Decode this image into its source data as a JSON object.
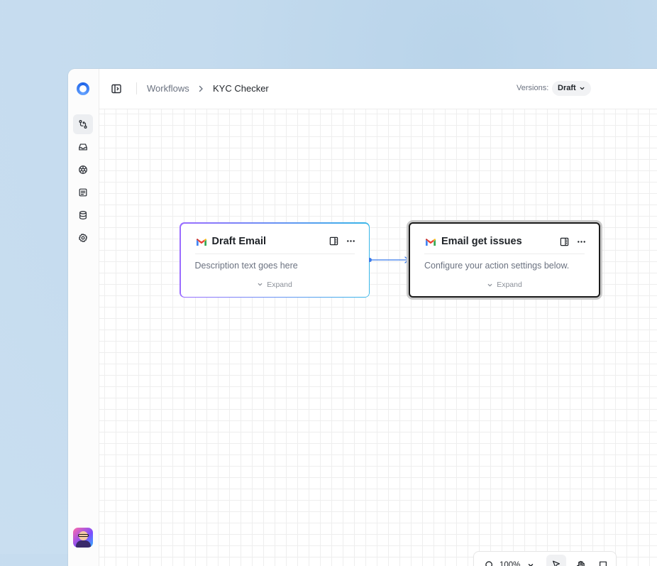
{
  "app": {
    "breadcrumb": [
      "Workflows",
      "KYC Checker"
    ],
    "versions_label": "Versions:",
    "version_value": "Draft"
  },
  "sidebar": {
    "items": [
      {
        "icon": "workflow-icon",
        "active": true
      },
      {
        "icon": "inbox-icon",
        "active": false
      },
      {
        "icon": "integrations-icon",
        "active": false
      },
      {
        "icon": "document-icon",
        "active": false
      },
      {
        "icon": "database-icon",
        "active": false
      },
      {
        "icon": "gear-icon",
        "active": false
      }
    ]
  },
  "nodes": [
    {
      "title": "Draft Email",
      "description": "Description text goes here",
      "expand_label": "Expand",
      "icon": "gmail-icon",
      "selected": false
    },
    {
      "title": "Email get issues",
      "description": "Configure your action settings below.",
      "expand_label": "Expand",
      "icon": "gmail-icon",
      "selected": true
    }
  ],
  "zoom_toolbar": {
    "zoom_level": "100%",
    "active_tool": "pointer"
  },
  "colors": {
    "accent": "#3a7bea",
    "node_gradient_start": "#9a6cff",
    "node_gradient_end": "#37b6e8",
    "background": "#c4dbee"
  }
}
